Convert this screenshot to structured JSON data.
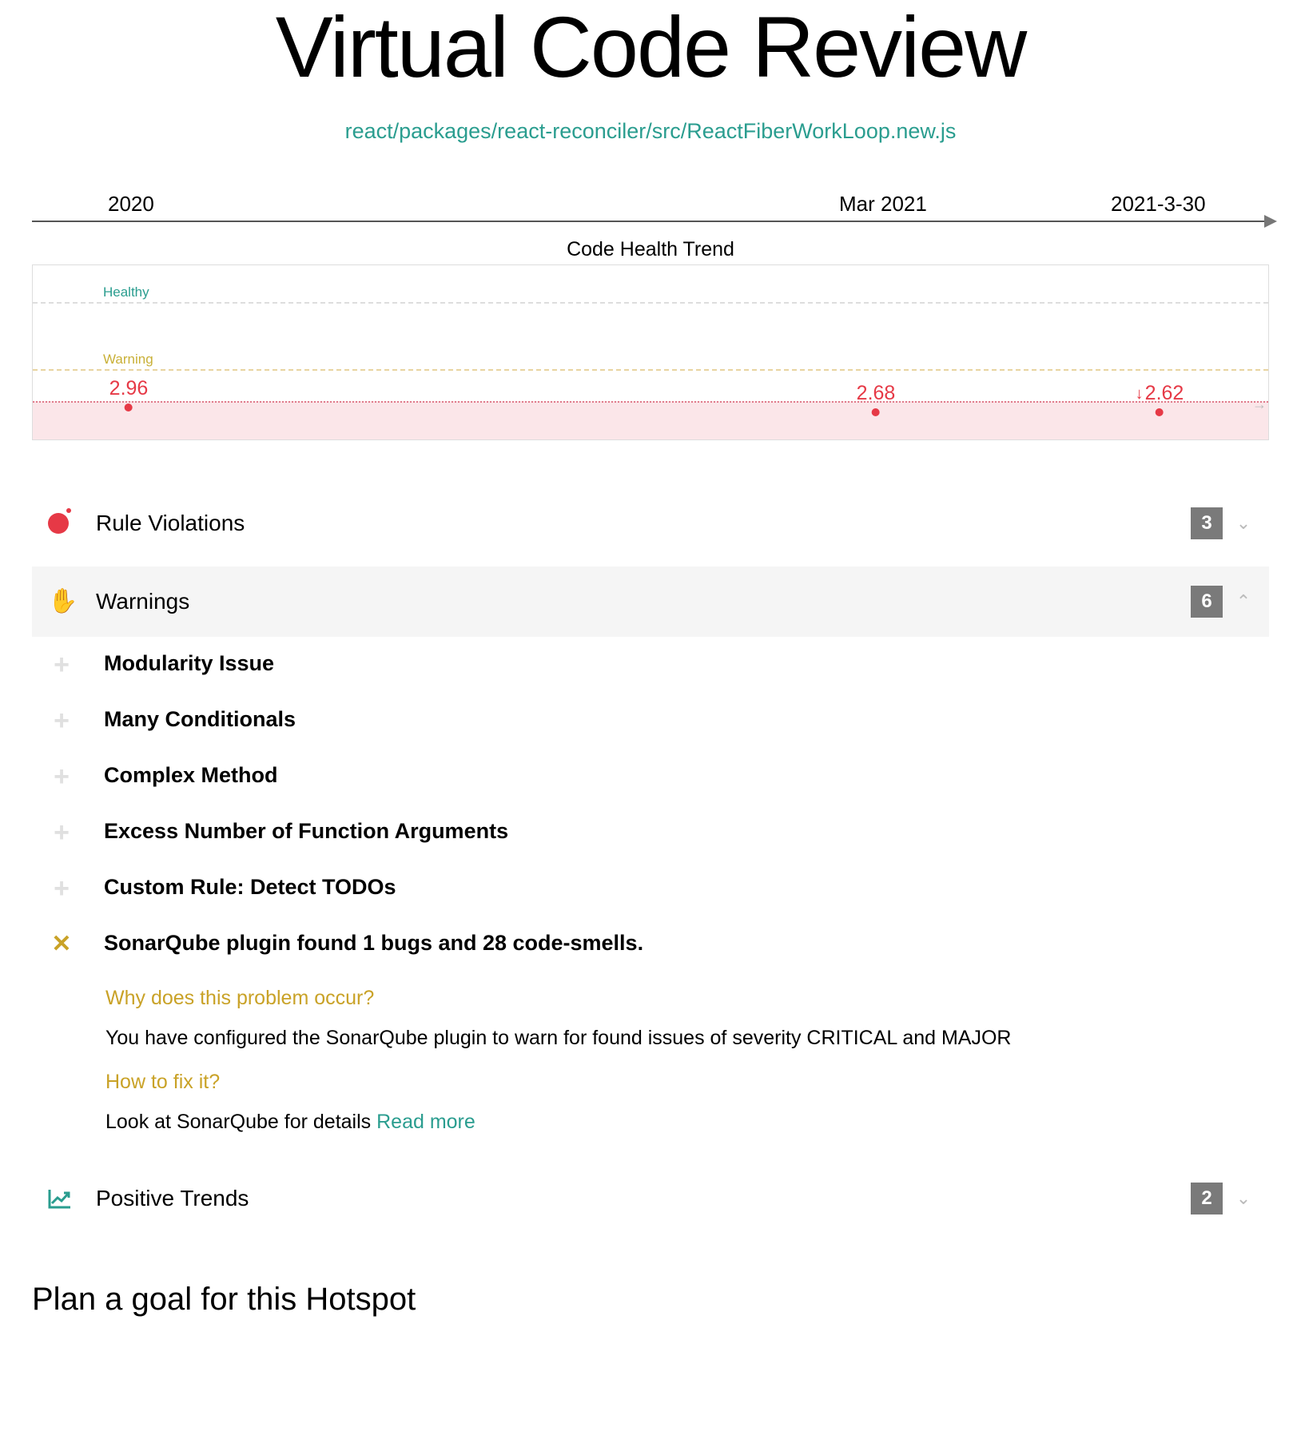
{
  "header": {
    "title": "Virtual Code Review",
    "file_path": "react/packages/react-reconciler/src/ReactFiberWorkLoop.new.js"
  },
  "timeline": {
    "labels": [
      "2020",
      "Mar 2021",
      "2021-3-30"
    ],
    "caption": "Code Health Trend"
  },
  "chart_data": {
    "type": "line",
    "title": "Code Health Trend",
    "bands": {
      "healthy_label": "Healthy",
      "warning_label": "Warning"
    },
    "x_ticks": [
      "2020",
      "Mar 2021",
      "2021-3-30"
    ],
    "series": [
      {
        "name": "code_health",
        "points": [
          {
            "x": "2020",
            "value": 2.96,
            "trend": "none"
          },
          {
            "x": "Mar 2021",
            "value": 2.68,
            "trend": "none"
          },
          {
            "x": "2021-3-30",
            "value": 2.62,
            "trend": "down"
          }
        ]
      }
    ]
  },
  "sections": {
    "rule_violations": {
      "title": "Rule Violations",
      "count": "3",
      "expanded": false
    },
    "warnings": {
      "title": "Warnings",
      "count": "6",
      "expanded": true,
      "items": [
        {
          "label": "Modularity Issue",
          "icon": "plus"
        },
        {
          "label": "Many Conditionals",
          "icon": "plus"
        },
        {
          "label": "Complex Method",
          "icon": "plus"
        },
        {
          "label": "Excess Number of Function Arguments",
          "icon": "plus"
        },
        {
          "label": "Custom Rule: Detect TODOs",
          "icon": "plus"
        },
        {
          "label": "SonarQube plugin found 1 bugs and 28 code-smells.",
          "icon": "x"
        }
      ],
      "detail": {
        "why_q": "Why does this problem occur?",
        "why_a": "You have configured the SonarQube plugin to warn for found issues of severity CRITICAL and MAJOR",
        "fix_q": "How to fix it?",
        "fix_a_prefix": "Look at SonarQube for details ",
        "fix_link": "Read more"
      }
    },
    "positive_trends": {
      "title": "Positive Trends",
      "count": "2",
      "expanded": false
    }
  },
  "goal_heading": "Plan a goal for this Hotspot"
}
